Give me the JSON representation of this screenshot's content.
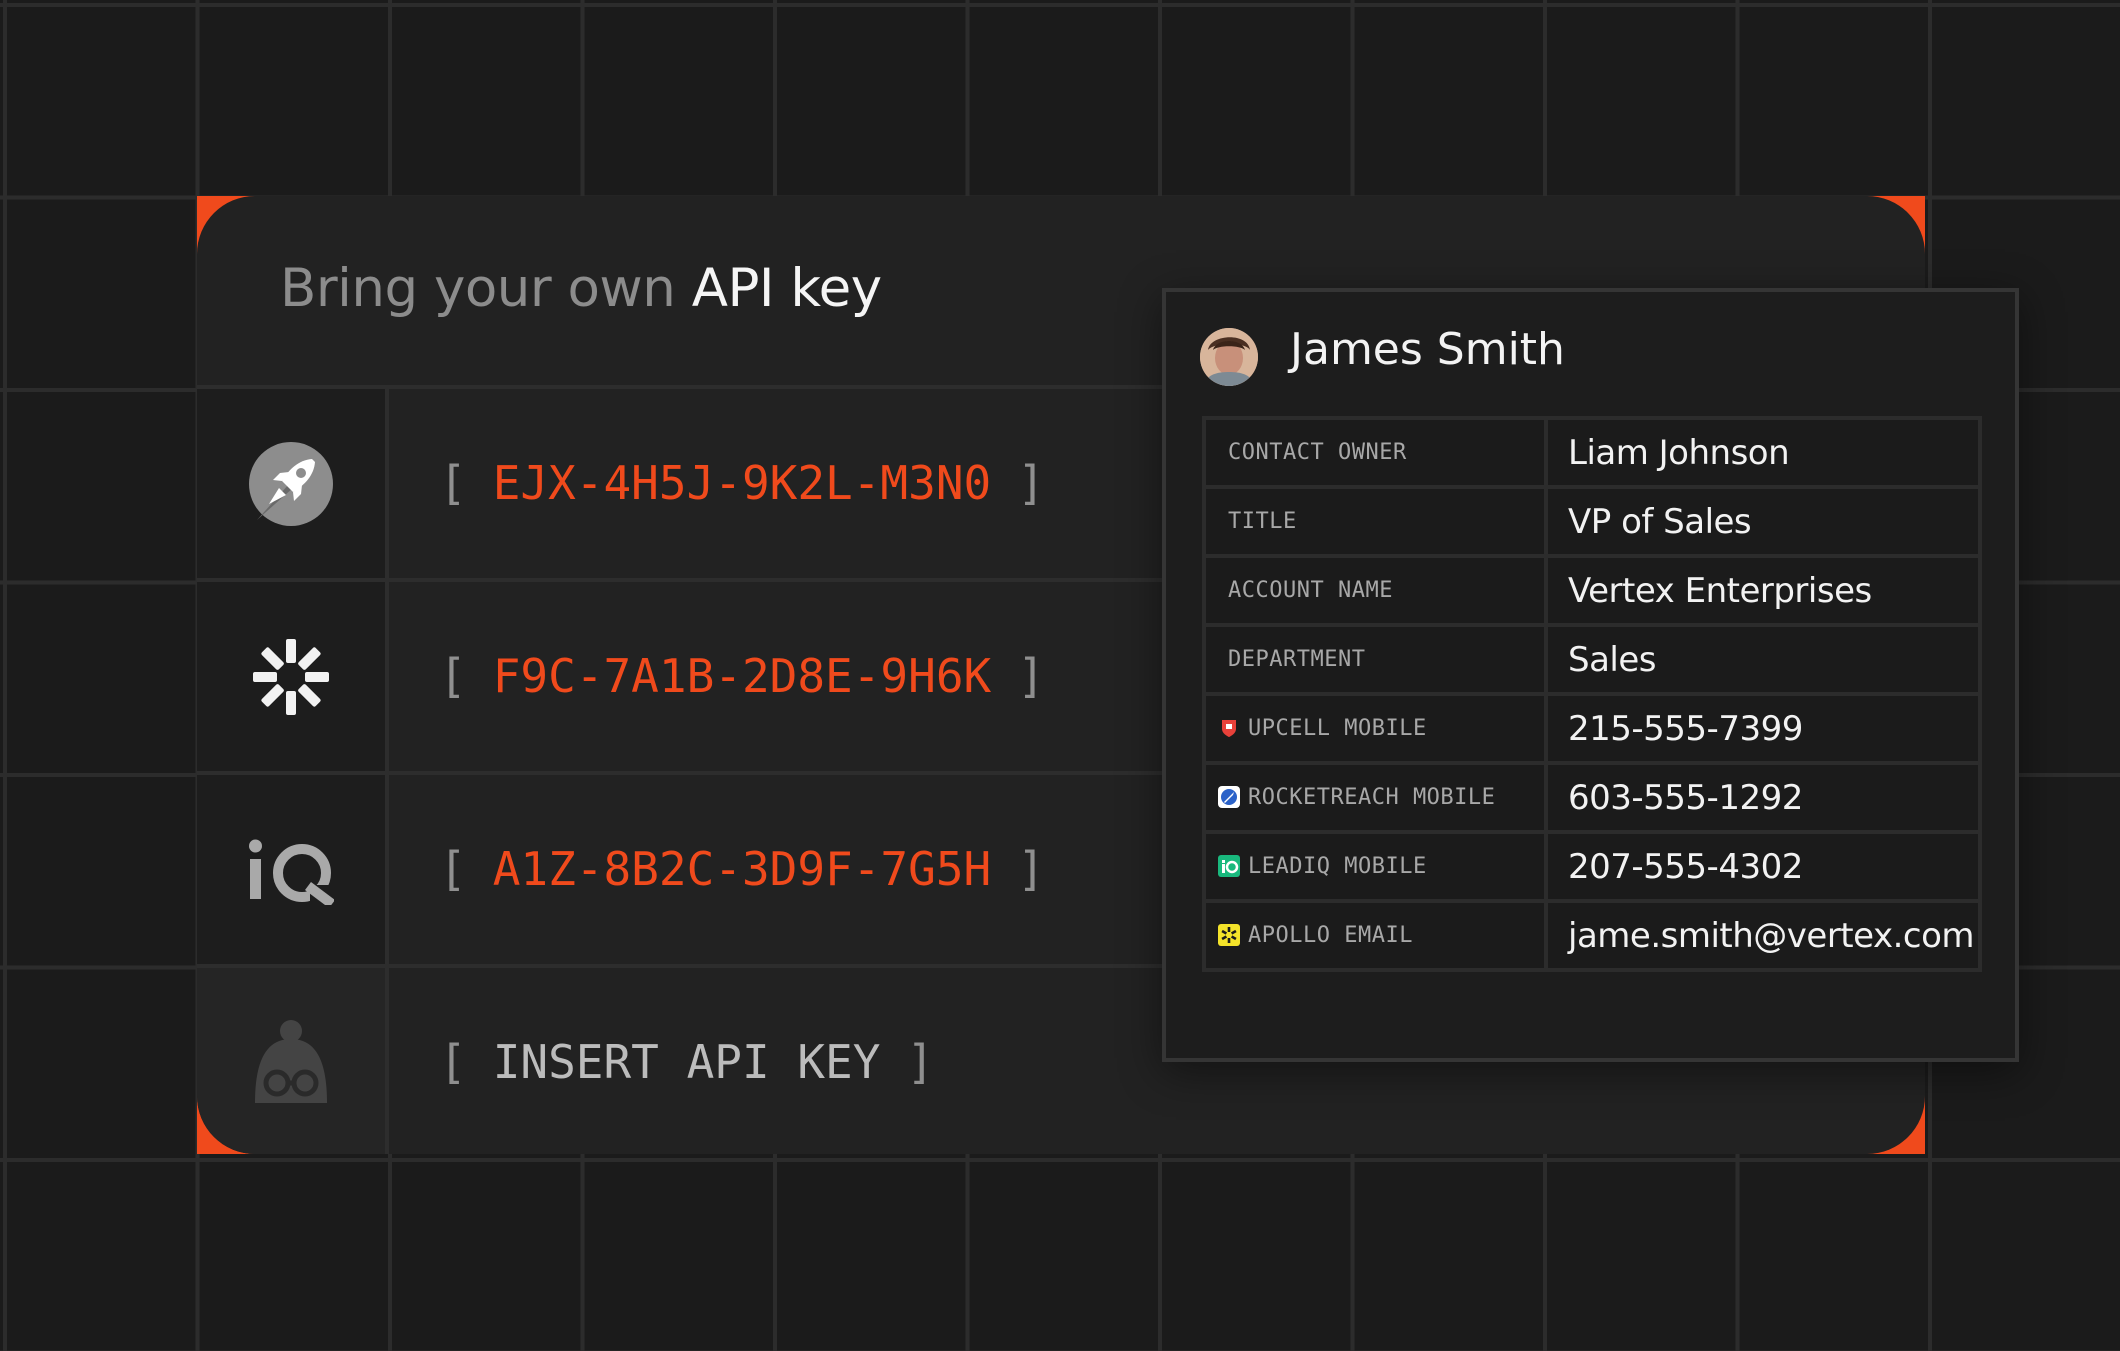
{
  "card": {
    "title_prefix": "Bring your own ",
    "title_emphasis": "API key"
  },
  "api_keys": [
    {
      "icon": "rocket-icon",
      "open": "[",
      "value": "EJX-4H5J-9K2L-M3N0",
      "close": "]"
    },
    {
      "icon": "apollo-burst-icon",
      "open": "[",
      "value": "F9C-7A1B-2D8E-9H6K",
      "close": "]"
    },
    {
      "icon": "leadiq-logo-icon",
      "open": "[",
      "value": "A1Z-8B2C-3D9F-7G5H",
      "close": "]"
    },
    {
      "icon": "person-glasses-icon",
      "open": "[",
      "placeholder": "INSERT API KEY",
      "close": "]"
    }
  ],
  "contact": {
    "name": "James Smith",
    "fields": [
      {
        "label": "CONTACT OWNER",
        "value": "Liam Johnson"
      },
      {
        "label": "TITLE",
        "value": "VP of Sales"
      },
      {
        "label": "ACCOUNT NAME",
        "value": "Vertex Enterprises"
      },
      {
        "label": "DEPARTMENT",
        "value": "Sales"
      },
      {
        "label": "UPCELL MOBILE",
        "value": "215-555-7399",
        "icon": "upcell-icon"
      },
      {
        "label": "ROCKETREACH MOBILE",
        "value": "603-555-1292",
        "icon": "rocketreach-icon"
      },
      {
        "label": "LEADIQ MOBILE",
        "value": "207-555-4302",
        "icon": "leadiq-icon"
      },
      {
        "label": "APOLLO EMAIL",
        "value": "jame.smith@vertex.com",
        "icon": "apollo-icon"
      }
    ]
  },
  "colors": {
    "accent": "#f04a1c",
    "background": "#1b1b1b",
    "card": "#222222"
  }
}
